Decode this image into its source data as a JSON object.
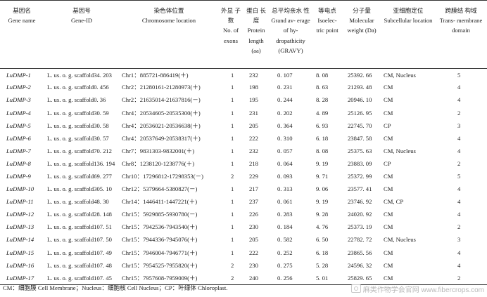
{
  "headers": [
    {
      "zh": "基因名",
      "en": "Gene name"
    },
    {
      "zh": "基因号",
      "en": "Gene-ID"
    },
    {
      "zh": "染色体位置",
      "en": "Chromosome location"
    },
    {
      "zh": "外显 子数",
      "en": "No. of exons"
    },
    {
      "zh": "蛋白 长度",
      "en": "Protein length (aa)"
    },
    {
      "zh": "总平均亲水 性",
      "en": "Grand av- erage of hy- dropathicity (GRAVY)"
    },
    {
      "zh": "等电点",
      "en": "Isoelec- tric point"
    },
    {
      "zh": "分子量",
      "en": "Molecular weight (Da)"
    },
    {
      "zh": "亚细胞定位",
      "en": "Subcellular location"
    },
    {
      "zh": "跨膜结 构域",
      "en": "Trans- membrane domain"
    }
  ],
  "rows": [
    {
      "name": "LuDMP-1",
      "gene_id": "L. us. o. g. scaffold34. 203",
      "location": "Chr1：885721-886419(＋)",
      "exons": "1",
      "length": "232",
      "gravy": "0. 107",
      "pi": "8. 08",
      "mw": "25392. 66",
      "subcellular": "CM, Nucleus",
      "tm": "5"
    },
    {
      "name": "LuDMP-2",
      "gene_id": "L. us. o. g. scaffold0. 456",
      "location": "Chr2：21280161-21280973(＋)",
      "exons": "1",
      "length": "198",
      "gravy": "0. 231",
      "pi": "8. 63",
      "mw": "21293. 48",
      "subcellular": "CM",
      "tm": "4"
    },
    {
      "name": "LuDMP-3",
      "gene_id": "L. us. o. g. scaffold0. 36",
      "location": "Chr2：21635014-21637816(－)",
      "exons": "1",
      "length": "195",
      "gravy": "0. 244",
      "pi": "8. 28",
      "mw": "20946. 10",
      "subcellular": "CM",
      "tm": "4"
    },
    {
      "name": "LuDMP-4",
      "gene_id": "L. us. o. g. scaffold30. 59",
      "location": "Chr4：20534605-20535300(＋)",
      "exons": "1",
      "length": "231",
      "gravy": "0. 202",
      "pi": "4. 89",
      "mw": "25126. 95",
      "subcellular": "CM",
      "tm": "2"
    },
    {
      "name": "LuDMP-5",
      "gene_id": "L. us. o. g. scaffold30. 58",
      "location": "Chr4：20536021-20536638(＋)",
      "exons": "1",
      "length": "205",
      "gravy": "0. 364",
      "pi": "6. 93",
      "mw": "22745. 70",
      "subcellular": "CP",
      "tm": "3"
    },
    {
      "name": "LuDMP-6",
      "gene_id": "L. us. o. g. scaffold30. 57",
      "location": "Chr4：20537649-20538317(＋)",
      "exons": "1",
      "length": "222",
      "gravy": "0. 310",
      "pi": "6. 18",
      "mw": "23847. 58",
      "subcellular": "CM",
      "tm": "4"
    },
    {
      "name": "LuDMP-7",
      "gene_id": "L. us. o. g. scaffold70. 212",
      "location": "Chr7：9831303-9832001(＋)",
      "exons": "1",
      "length": "232",
      "gravy": "0. 057",
      "pi": "8. 08",
      "mw": "25375. 63",
      "subcellular": "CM, Nucleus",
      "tm": "4"
    },
    {
      "name": "LuDMP-8",
      "gene_id": "L. us. o. g. scaffold136. 194",
      "location": "Chr8：1238120-1238776(＋)",
      "exons": "1",
      "length": "218",
      "gravy": "0. 064",
      "pi": "9. 19",
      "mw": "23883. 09",
      "subcellular": "CP",
      "tm": "2"
    },
    {
      "name": "LuDMP-9",
      "gene_id": "L. us. o. g. scaffold69. 277",
      "location": "Chr10：17296812-17298353(－)",
      "exons": "2",
      "length": "229",
      "gravy": "0. 093",
      "pi": "9. 71",
      "mw": "25372. 99",
      "subcellular": "CM",
      "tm": "5"
    },
    {
      "name": "LuDMP-10",
      "gene_id": "L. us. o. g. scaffold305. 10",
      "location": "Chr12：5379664-5380827(－)",
      "exons": "1",
      "length": "217",
      "gravy": "0. 313",
      "pi": "9. 06",
      "mw": "23577. 41",
      "subcellular": "CM",
      "tm": "4"
    },
    {
      "name": "LuDMP-11",
      "gene_id": "L. us. o. g. scaffold48. 30",
      "location": "Chr14：1446411-1447221(＋)",
      "exons": "1",
      "length": "237",
      "gravy": "0. 061",
      "pi": "9. 19",
      "mw": "23746. 92",
      "subcellular": "CM, CP",
      "tm": "4"
    },
    {
      "name": "LuDMP-12",
      "gene_id": "L. us. o. g. scaffold28. 148",
      "location": "Chr15：5929885-5930780(－)",
      "exons": "1",
      "length": "226",
      "gravy": "0. 283",
      "pi": "9. 28",
      "mw": "24020. 92",
      "subcellular": "CM",
      "tm": "4"
    },
    {
      "name": "LuDMP-13",
      "gene_id": "L. us. o. g. scaffold107. 51",
      "location": "Chr15：7942536-7943540(＋)",
      "exons": "1",
      "length": "230",
      "gravy": "0. 184",
      "pi": "4. 76",
      "mw": "25373. 19",
      "subcellular": "CM",
      "tm": "2"
    },
    {
      "name": "LuDMP-14",
      "gene_id": "L. us. o. g. scaffold107. 50",
      "location": "Chr15：7944336-7945076(＋)",
      "exons": "1",
      "length": "205",
      "gravy": "0. 582",
      "pi": "6. 50",
      "mw": "22782. 72",
      "subcellular": "CM, Nucleus",
      "tm": "3"
    },
    {
      "name": "LuDMP-15",
      "gene_id": "L. us. o. g. scaffold107. 49",
      "location": "Chr15：7946004-7946771(＋)",
      "exons": "1",
      "length": "222",
      "gravy": "0. 252",
      "pi": "6. 18",
      "mw": "23865. 56",
      "subcellular": "CM",
      "tm": "4"
    },
    {
      "name": "LuDMP-16",
      "gene_id": "L. us. o. g. scaffold107. 48",
      "location": "Chr15：7954525-7955820(＋)",
      "exons": "2",
      "length": "230",
      "gravy": "0. 275",
      "pi": "5. 28",
      "mw": "24596. 32",
      "subcellular": "CM",
      "tm": "4"
    },
    {
      "name": "LuDMP-17",
      "gene_id": "L. us. o. g. scaffold107. 45",
      "location": "Chr15：7957608-7959009(＋)",
      "exons": "2",
      "length": "240",
      "gravy": "0. 256",
      "pi": "5. 01",
      "mw": "25829. 65",
      "subcellular": "CM",
      "tm": "2"
    }
  ],
  "footnote": "CM：细胞膜 Cell Membrane；Nucleus：细胞核 Cell Nucleus；CP：叶绿体 Chloroplast.",
  "watermark": "麻类作物学会官网 www.fibercrops.com"
}
